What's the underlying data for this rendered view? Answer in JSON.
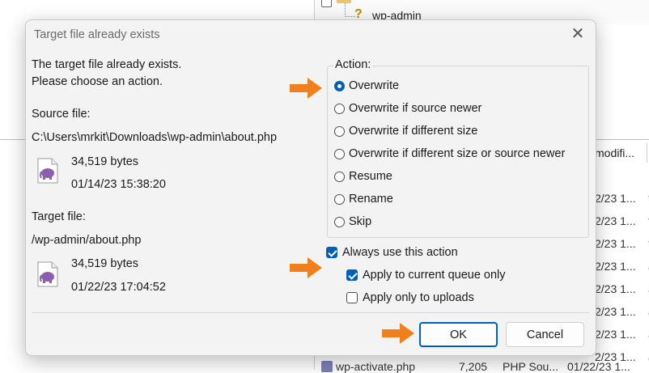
{
  "background": {
    "tree_item_label": "wp-admin",
    "list_header": "modifi...",
    "list_rows": [
      {
        "date": "2/23 1...",
        "type": "t"
      },
      {
        "date": "2/23 1...",
        "type": "t"
      },
      {
        "date": "2/23 1...",
        "type": "t"
      },
      {
        "date": "2/23 1...",
        "type": "a"
      },
      {
        "date": "2/23 1...",
        "type": "a"
      },
      {
        "date": "2/23 1...",
        "type": "a"
      },
      {
        "date": "2/23 1...",
        "type": "a"
      },
      {
        "date": "2/23 1...",
        "type": "a"
      },
      {
        "date": "2/23 1...",
        "type": "a"
      }
    ],
    "bottom_row": {
      "name": "wp-activate.php",
      "size": "7,205",
      "type": "PHP Sou...",
      "date": "01/22/23 1..."
    }
  },
  "dialog": {
    "title": "Target file already exists",
    "message_line1": "The target file already exists.",
    "message_line2": "Please choose an action.",
    "source": {
      "label": "Source file:",
      "path": "C:\\Users\\mrkit\\Downloads\\wp-admin\\about.php",
      "size": "34,519 bytes",
      "date": "01/14/23 15:38:20",
      "icon": "php-file-icon"
    },
    "target": {
      "label": "Target file:",
      "path": "/wp-admin/about.php",
      "size": "34,519 bytes",
      "date": "01/22/23 17:04:52",
      "icon": "php-file-icon"
    },
    "action_group_label": "Action:",
    "actions": [
      {
        "label": "Overwrite",
        "selected": true
      },
      {
        "label": "Overwrite if source newer",
        "selected": false
      },
      {
        "label": "Overwrite if different size",
        "selected": false
      },
      {
        "label": "Overwrite if different size or source newer",
        "selected": false
      },
      {
        "label": "Resume",
        "selected": false
      },
      {
        "label": "Rename",
        "selected": false
      },
      {
        "label": "Skip",
        "selected": false
      }
    ],
    "always_use": {
      "label": "Always use this action",
      "checked": true
    },
    "apply_queue": {
      "label": "Apply to current queue only",
      "checked": true
    },
    "apply_uploads": {
      "label": "Apply only to uploads",
      "checked": false
    },
    "ok_label": "OK",
    "cancel_label": "Cancel",
    "accent_color": "#005fb8",
    "annotation_arrow_color": "#f07f1e"
  }
}
